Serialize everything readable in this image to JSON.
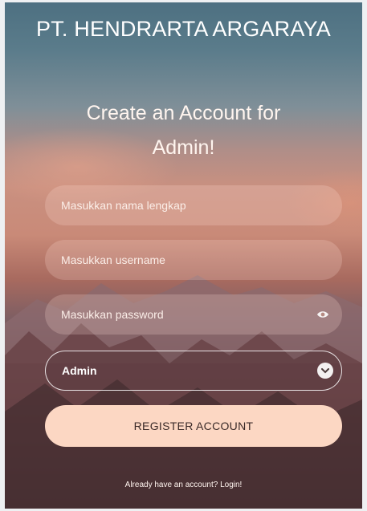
{
  "brand": {
    "title": "PT. HENDRARTA ARGARAYA"
  },
  "form": {
    "heading_line1": "Create an Account for",
    "heading_line2": "Admin!",
    "fullname": {
      "placeholder": "Masukkan nama lengkap",
      "value": ""
    },
    "username": {
      "placeholder": "Masukkan username",
      "value": ""
    },
    "password": {
      "placeholder": "Masukkan password",
      "value": "",
      "toggle_icon": "eye-icon"
    },
    "role": {
      "selected": "Admin",
      "dropdown_icon": "chevron-down-icon"
    },
    "register_label": "REGISTER ACCOUNT",
    "login_link": "Already have an account? Login!"
  },
  "colors": {
    "button_bg": "#fcd7c3",
    "button_text": "#3a2a28",
    "field_bg": "rgba(255,225,215,0.22)",
    "text": "#ffffff"
  }
}
